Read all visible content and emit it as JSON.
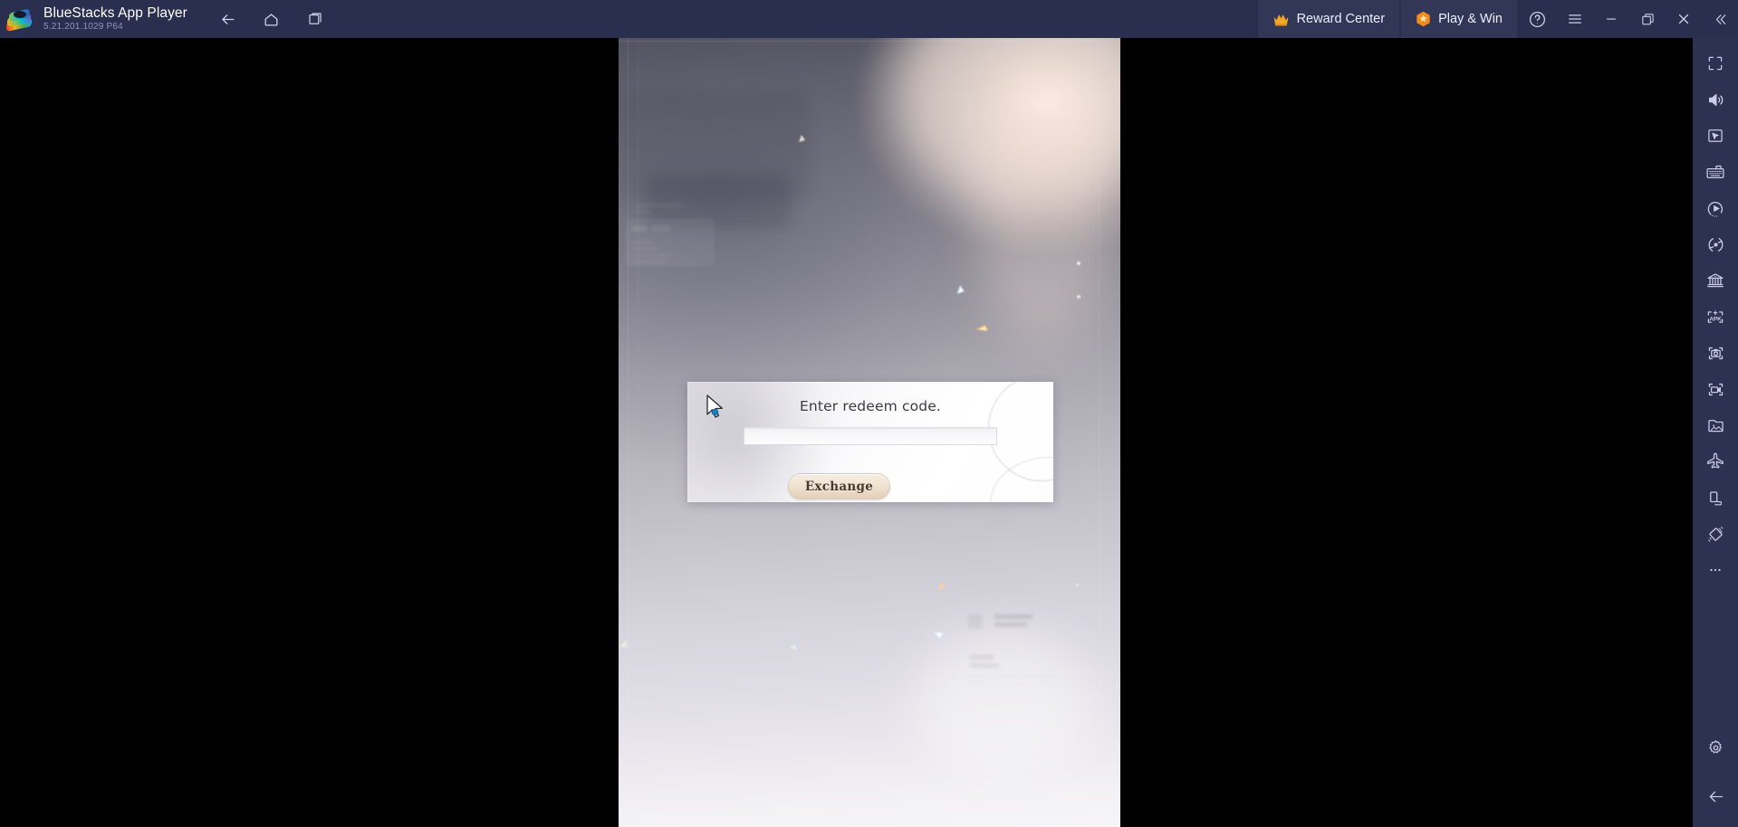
{
  "titlebar": {
    "logo_icon": "bluestacks-logo",
    "app_name": "BlueStacks App Player",
    "version": "5.21.201.1029  P64",
    "nav": [
      {
        "name": "back",
        "icon": "arrow-left-icon",
        "label": "Back"
      },
      {
        "name": "home",
        "icon": "home-icon",
        "label": "Home"
      },
      {
        "name": "multi-instance",
        "icon": "copy-window-icon",
        "label": "Instance Manager"
      }
    ],
    "reward_center": {
      "label": "Reward Center",
      "icon": "crown-icon"
    },
    "play_and_win": {
      "label": "Play & Win",
      "icon": "gem-icon"
    },
    "window_controls": [
      {
        "name": "help",
        "icon": "question-circle-icon",
        "label": "Help"
      },
      {
        "name": "menu",
        "icon": "hamburger-icon",
        "label": "Menu"
      },
      {
        "name": "minimize",
        "icon": "minimize-icon",
        "label": "Minimize"
      },
      {
        "name": "maximize",
        "icon": "restore-icon",
        "label": "Restore"
      },
      {
        "name": "close",
        "icon": "close-icon",
        "label": "Close"
      },
      {
        "name": "collapse-sidebar",
        "icon": "chevron-double-left-icon",
        "label": "Collapse"
      }
    ]
  },
  "dialog": {
    "title": "Enter redeem code.",
    "input_value": "",
    "input_placeholder": "",
    "button_label": "Exchange"
  },
  "sidebar": {
    "items": [
      {
        "name": "fullscreen",
        "icon": "fullscreen-icon",
        "label": "Full screen"
      },
      {
        "name": "volume",
        "icon": "volume-icon",
        "label": "Volume"
      },
      {
        "name": "game-controls",
        "icon": "cursor-screen-icon",
        "label": "Game controls"
      },
      {
        "name": "keymapping",
        "icon": "keyboard-icon",
        "label": "Controls editor"
      },
      {
        "name": "macro-recorder",
        "icon": "macro-play-icon",
        "label": "Macro recorder"
      },
      {
        "name": "multi-instance-sync",
        "icon": "sync-circle-icon",
        "label": "Sync operations"
      },
      {
        "name": "eco-mode",
        "icon": "bank-icon",
        "label": "Eco mode"
      },
      {
        "name": "install-apk",
        "icon": "apk-install-icon",
        "label": "Install APK"
      },
      {
        "name": "screenshot",
        "icon": "camera-icon",
        "label": "Screenshot"
      },
      {
        "name": "record-screen",
        "icon": "video-record-icon",
        "label": "Record screen"
      },
      {
        "name": "media-manager",
        "icon": "media-folder-icon",
        "label": "Media manager"
      },
      {
        "name": "airplane",
        "icon": "airplane-icon",
        "label": "Game orientation"
      },
      {
        "name": "rotate",
        "icon": "rotate-device-icon",
        "label": "Rotate"
      },
      {
        "name": "shake",
        "icon": "shake-icon",
        "label": "Shake"
      },
      {
        "name": "more",
        "icon": "ellipsis-icon",
        "label": "More"
      }
    ],
    "bottom_items": [
      {
        "name": "settings",
        "icon": "gear-icon",
        "label": "Settings"
      },
      {
        "name": "back",
        "icon": "arrow-left-icon",
        "label": "Back"
      }
    ]
  },
  "colors": {
    "titlebar_bg": "#2a2e4f",
    "pill_bg": "#323657",
    "sidebar_bg": "#2d3152",
    "accent_orange": "#f5a623",
    "text_primary": "#ffffff",
    "text_muted": "#8f93b5",
    "button_beige": "#ead9c5"
  }
}
